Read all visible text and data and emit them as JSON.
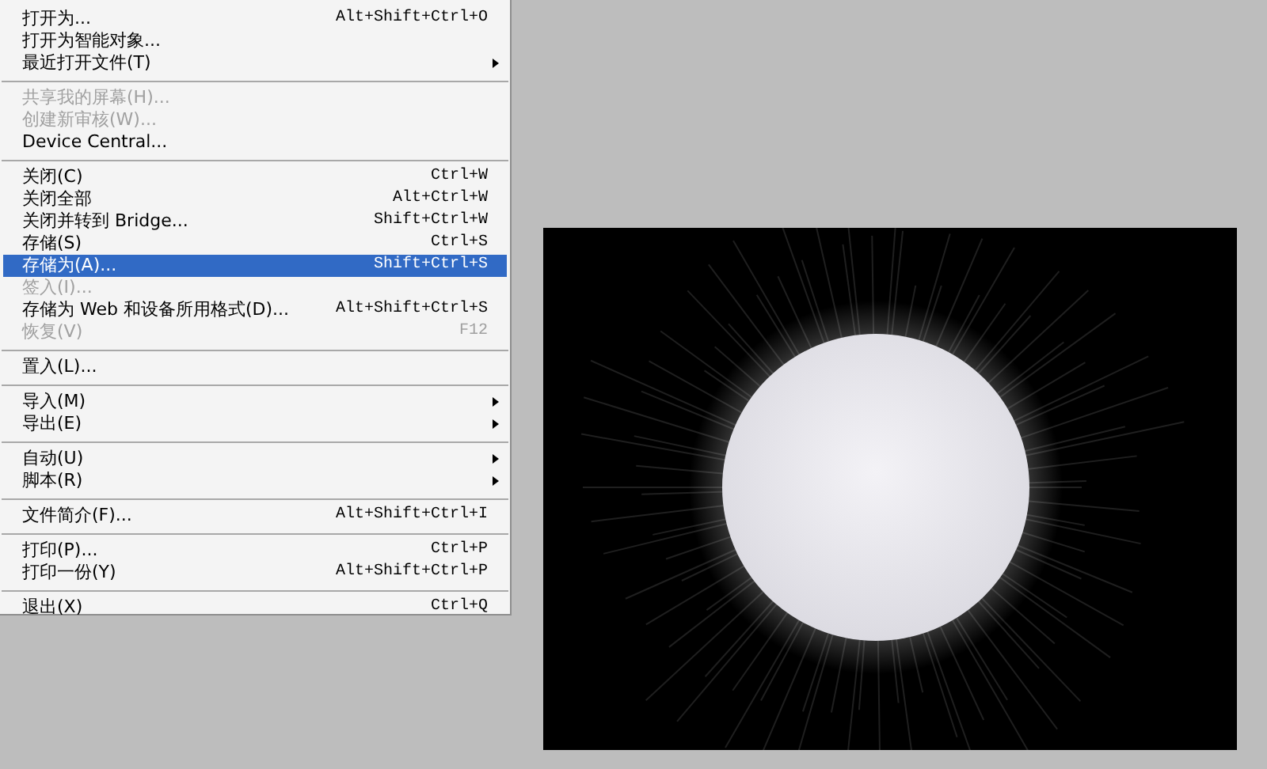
{
  "menu": {
    "groups": [
      [
        {
          "label": "打开为...",
          "shortcut": "Alt+Shift+Ctrl+O",
          "disabled": false,
          "selected": false,
          "submenu": false
        },
        {
          "label": "打开为智能对象...",
          "disabled": false,
          "selected": false,
          "submenu": false
        },
        {
          "label": "最近打开文件(T)",
          "disabled": false,
          "selected": false,
          "submenu": true
        }
      ],
      [
        {
          "label": "共享我的屏幕(H)...",
          "disabled": true,
          "selected": false,
          "submenu": false
        },
        {
          "label": "创建新审核(W)...",
          "disabled": true,
          "selected": false,
          "submenu": false
        },
        {
          "label": "Device Central...",
          "disabled": false,
          "selected": false,
          "submenu": false
        }
      ],
      [
        {
          "label": "关闭(C)",
          "shortcut": "Ctrl+W",
          "disabled": false,
          "selected": false,
          "submenu": false
        },
        {
          "label": "关闭全部",
          "shortcut": "Alt+Ctrl+W",
          "disabled": false,
          "selected": false,
          "submenu": false
        },
        {
          "label": "关闭并转到 Bridge...",
          "shortcut": "Shift+Ctrl+W",
          "disabled": false,
          "selected": false,
          "submenu": false
        },
        {
          "label": "存储(S)",
          "shortcut": "Ctrl+S",
          "disabled": false,
          "selected": false,
          "submenu": false
        },
        {
          "label": "存储为(A)...",
          "shortcut": "Shift+Ctrl+S",
          "disabled": false,
          "selected": true,
          "submenu": false
        },
        {
          "label": "签入(I)...",
          "disabled": true,
          "selected": false,
          "submenu": false
        },
        {
          "label": "存储为 Web 和设备所用格式(D)...",
          "shortcut": "Alt+Shift+Ctrl+S",
          "disabled": false,
          "selected": false,
          "submenu": false
        },
        {
          "label": "恢复(V)",
          "shortcut": "F12",
          "disabled": true,
          "selected": false,
          "submenu": false
        }
      ],
      [
        {
          "label": "置入(L)...",
          "disabled": false,
          "selected": false,
          "submenu": false
        }
      ],
      [
        {
          "label": "导入(M)",
          "disabled": false,
          "selected": false,
          "submenu": true
        },
        {
          "label": "导出(E)",
          "disabled": false,
          "selected": false,
          "submenu": true
        }
      ],
      [
        {
          "label": "自动(U)",
          "disabled": false,
          "selected": false,
          "submenu": true
        },
        {
          "label": "脚本(R)",
          "disabled": false,
          "selected": false,
          "submenu": true
        }
      ],
      [
        {
          "label": "文件简介(F)...",
          "shortcut": "Alt+Shift+Ctrl+I",
          "disabled": false,
          "selected": false,
          "submenu": false
        }
      ],
      [
        {
          "label": "打印(P)...",
          "shortcut": "Ctrl+P",
          "disabled": false,
          "selected": false,
          "submenu": false
        },
        {
          "label": "打印一份(Y)",
          "shortcut": "Alt+Shift+Ctrl+P",
          "disabled": false,
          "selected": false,
          "submenu": false
        }
      ],
      [
        {
          "label": "退出(X)",
          "shortcut": "Ctrl+Q",
          "disabled": false,
          "selected": false,
          "submenu": false
        }
      ]
    ]
  }
}
